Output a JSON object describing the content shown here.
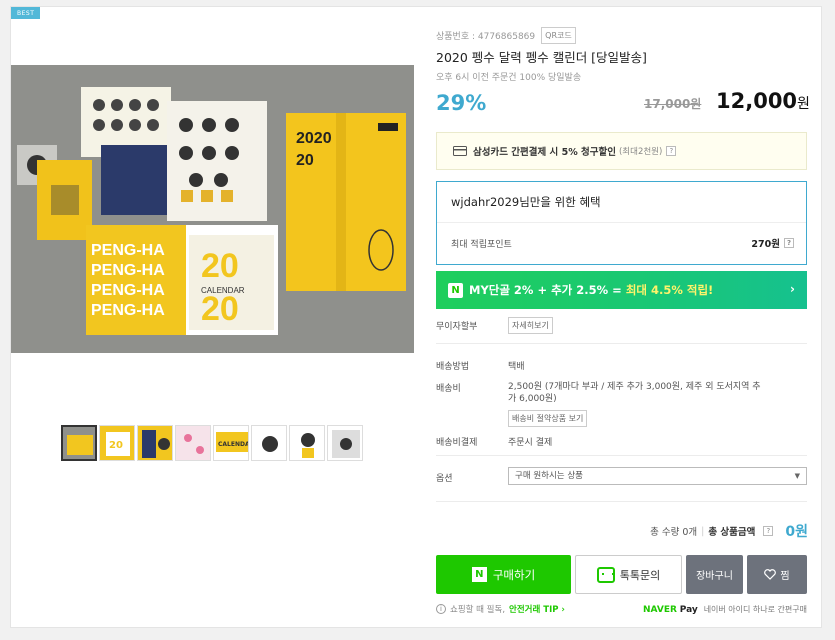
{
  "badge": "BEST",
  "product": {
    "number_label": "상품번호 : 4776865869",
    "qr_label": "QR코드",
    "title": "2020 펭수 달력 펭수 캘린더 [당일발송]",
    "ship_note": "오후 6시 이전 주문건 100% 당일발송",
    "discount": "29%",
    "original_price": "17,000원",
    "sale_price": "12,000",
    "sale_currency": "원"
  },
  "card_promo": {
    "label": "삼성카드 간편결제 시 5% 청구할인",
    "sub": "(최대2천원)"
  },
  "benefit": {
    "title": "wjdahr2029님만을 위한 혜택",
    "point_label": "최대 적립포인트",
    "point_value": "270원"
  },
  "my_banner": {
    "logo": "N",
    "text": "MY단골 2% + 추가 2.5% =",
    "highlight": "최대 4.5% 적립!"
  },
  "rows": {
    "interest_free_label": "무이자할부",
    "interest_free_btn": "자세히보기",
    "ship_method_label": "배송방법",
    "ship_method_value": "택배",
    "ship_fee_label": "배송비",
    "ship_fee_value_1": "2,500원 (7개마다 부과 / 제주 추가 3,000원, 제주 외 도서지역 추",
    "ship_fee_value_2": "가 6,000원)",
    "bundle_btn": "배송비 절약상품 보기",
    "ship_pay_label": "배송비결제",
    "ship_pay_value": "주문시 결제",
    "option_label": "옵션",
    "option_placeholder": "구매 원하시는 상품"
  },
  "total": {
    "qty_label": "총 수량 0개",
    "amount_label": "총 상품금액",
    "amount_value": "0원"
  },
  "buttons": {
    "buy": "구매하기",
    "talk": "톡톡문의",
    "cart": "장바구니",
    "wish": "찜"
  },
  "footer": {
    "info": "쇼핑할 때 필독,",
    "safe_tip": "안전거래 TIP",
    "naver": "NAVER",
    "pay": "Pay",
    "pay_desc": "네이버 아이디 하나로 간편구매"
  },
  "thumbnails": [
    "thumb-1",
    "thumb-2",
    "thumb-3",
    "thumb-4",
    "thumb-5",
    "thumb-6",
    "thumb-7",
    "thumb-8"
  ]
}
